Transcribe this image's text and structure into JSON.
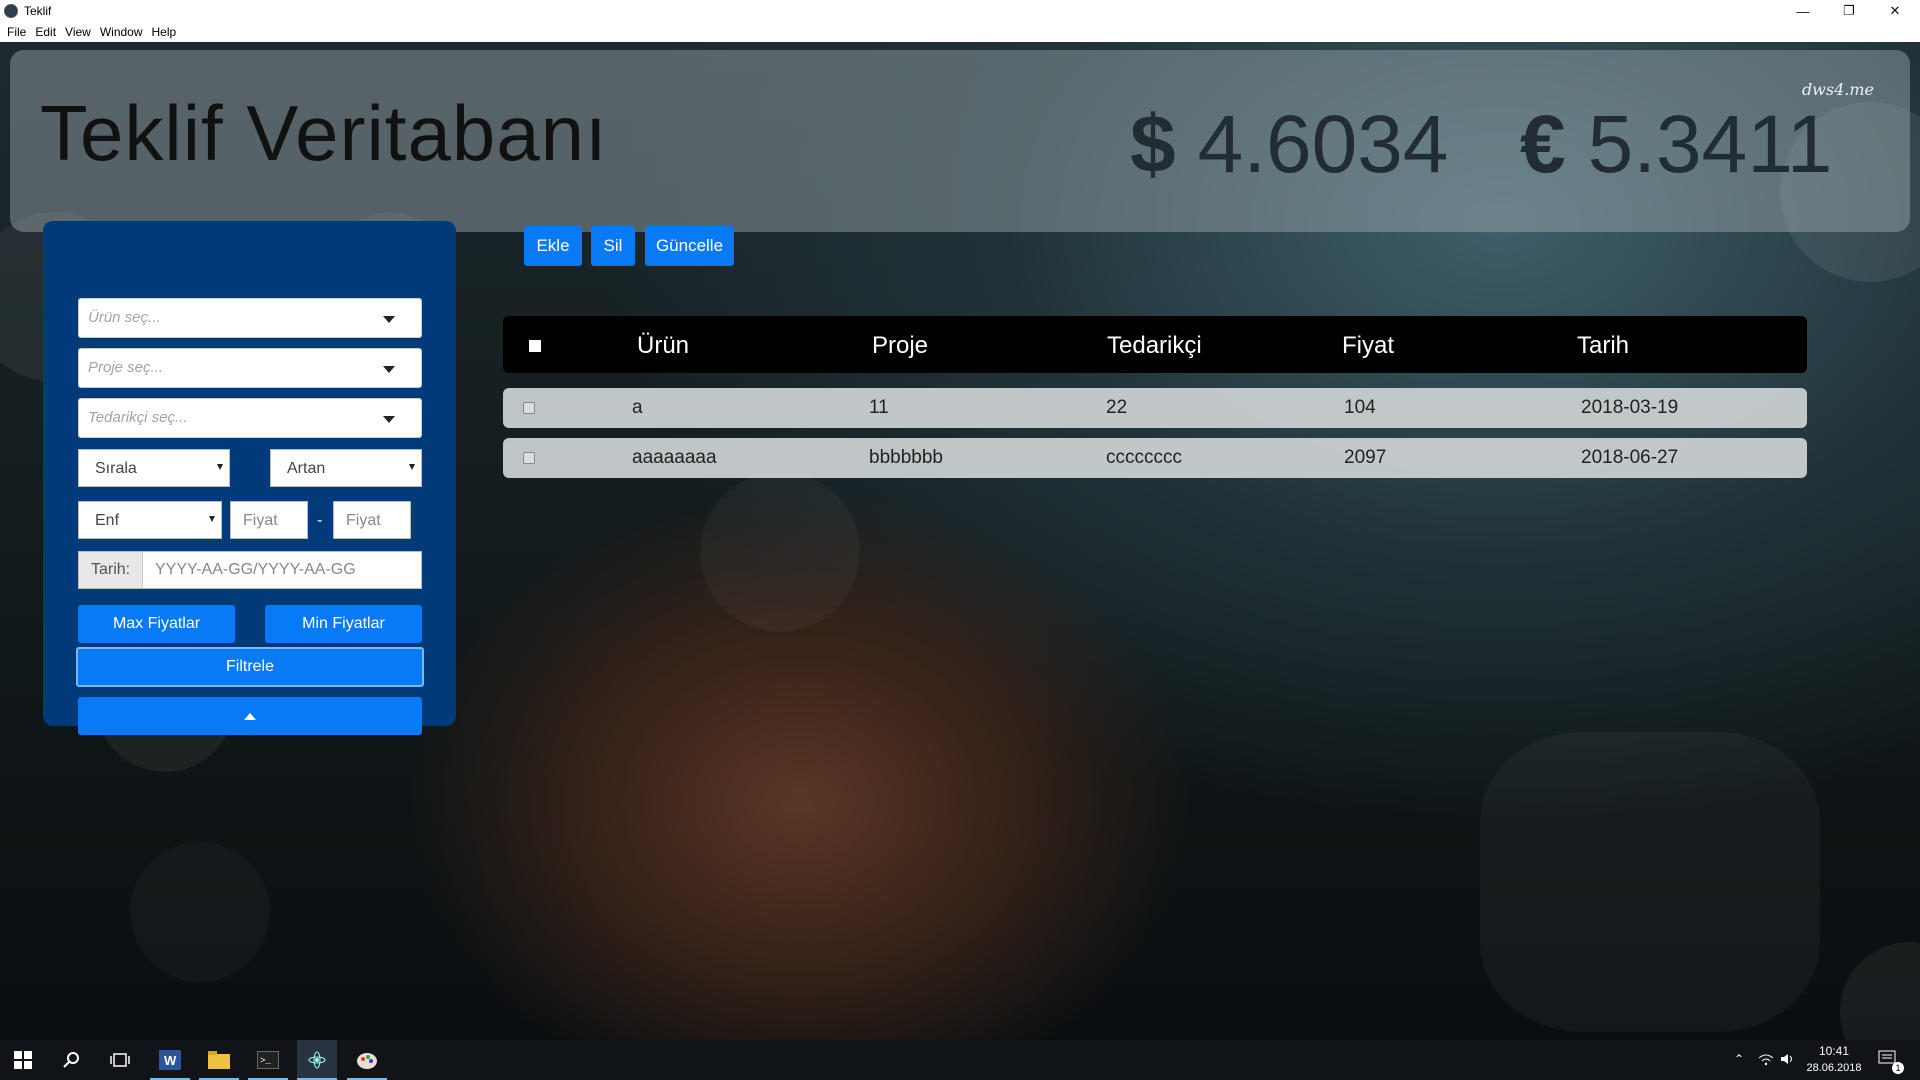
{
  "window": {
    "title": "Teklif",
    "menu": [
      "File",
      "Edit",
      "View",
      "Window",
      "Help"
    ]
  },
  "header": {
    "title": "Teklif Veritabanı",
    "usd_symbol": "$",
    "usd_value": "4.6034",
    "eur_symbol": "€",
    "eur_value": "5.3411",
    "watermark": "dws4.me"
  },
  "filters": {
    "product_placeholder": "Ürün seç...",
    "project_placeholder": "Proje seç...",
    "supplier_placeholder": "Tedarikçi seç...",
    "sort_select": "Sırala",
    "order_select": "Artan",
    "price_type_select": "Enf",
    "price_min_placeholder": "Fiyat",
    "price_max_placeholder": "Fiyat",
    "price_dash": "-",
    "date_label": "Tarih:",
    "date_placeholder": "YYYY-AA-GG/YYYY-AA-GG",
    "max_prices_label": "Max Fiyatlar",
    "min_prices_label": "Min Fiyatlar",
    "filter_label": "Filtrele"
  },
  "toolbar": {
    "add_label": "Ekle",
    "delete_label": "Sil",
    "update_label": "Güncelle"
  },
  "table": {
    "columns": [
      "Ürün",
      "Proje",
      "Tedarikçi",
      "Fiyat",
      "Tarih"
    ],
    "rows": [
      [
        "a",
        "11",
        "22",
        "104",
        "2018-03-19"
      ],
      [
        "aaaaaaaa",
        "bbbbbbb",
        "cccccccc",
        "2097",
        "2018-06-27"
      ]
    ]
  },
  "taskbar": {
    "time": "10:41",
    "date": "28.06.2018",
    "notification_count": "1"
  },
  "colors": {
    "accent": "#087af6",
    "panel": "#003a78"
  }
}
